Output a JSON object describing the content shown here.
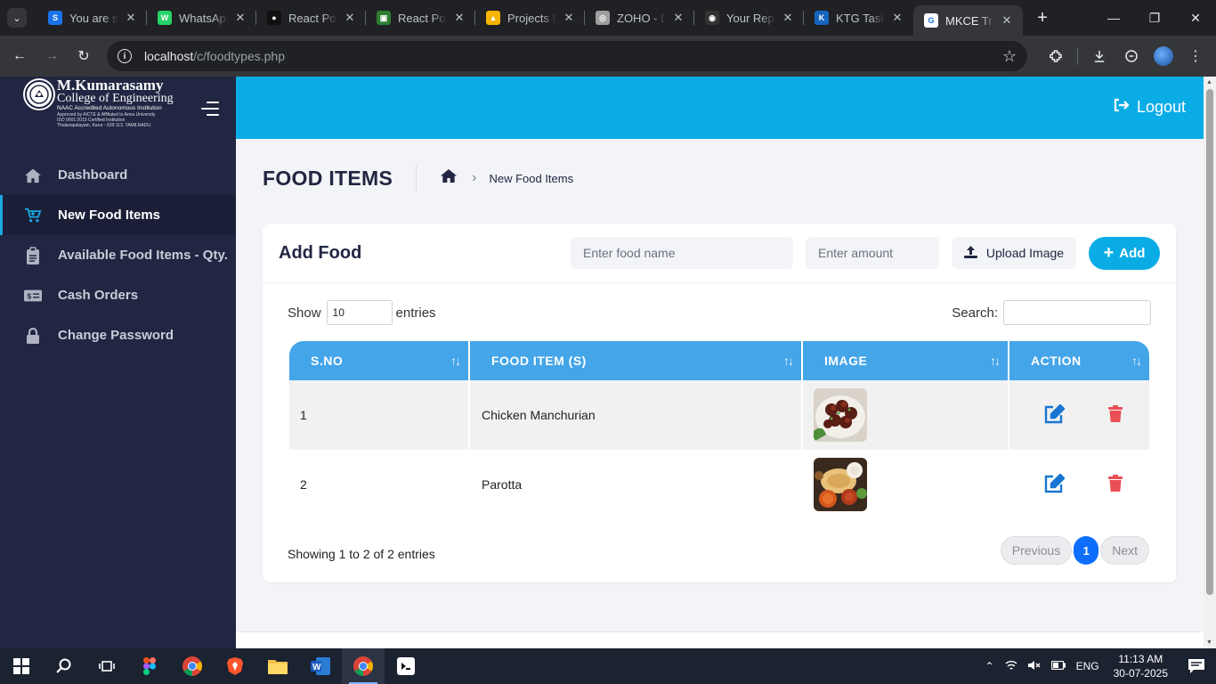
{
  "browser": {
    "tabs": [
      {
        "title": "You are signed in",
        "icon_color": "#1a73e8",
        "icon": "S"
      },
      {
        "title": "WhatsApp",
        "icon_color": "#25d366",
        "icon": "W"
      },
      {
        "title": "React Portfolio",
        "icon_color": "#111111",
        "icon": "●"
      },
      {
        "title": "React Portfolio",
        "icon_color": "#2e7d32",
        "icon": "▣"
      },
      {
        "title": "Projects Drive",
        "icon_color": "#f4b400",
        "icon": "▲"
      },
      {
        "title": "ZOHO - Dashboard",
        "icon_color": "#9e9e9e",
        "icon": "◎"
      },
      {
        "title": "Your Repositories",
        "icon_color": "#333333",
        "icon": "◉"
      },
      {
        "title": "KTG TaskFlow",
        "icon_color": "#1565c0",
        "icon": "K"
      },
      {
        "title": "MKCE Tray",
        "icon_color": "#ffffff",
        "icon": "G",
        "active": true
      }
    ],
    "url_host": "localhost",
    "url_path": "/c/foodtypes.php"
  },
  "sidebar": {
    "logo": {
      "line1": "M.Kumarasamy",
      "line2": "College of Engineering",
      "line3": "NAAC Accredited Autonomous Institution",
      "line4": "Approved by AICTE & Affiliated to Anna University",
      "line5": "ISO 9001:2015 Certified Institution",
      "line6": "Thalavapalayam, Karur - 639 113, TAMILNADU."
    },
    "items": [
      {
        "label": "Dashboard",
        "icon": "home-icon"
      },
      {
        "label": "New Food Items",
        "icon": "cart-icon",
        "active": true
      },
      {
        "label": "Available Food Items - Qty.",
        "icon": "clipboard-icon"
      },
      {
        "label": "Cash Orders",
        "icon": "money-icon"
      },
      {
        "label": "Change Password",
        "icon": "lock-icon"
      }
    ]
  },
  "topbar": {
    "logout_label": "Logout"
  },
  "page": {
    "title": "FOOD ITEMS",
    "breadcrumb_current": "New Food Items"
  },
  "add_food": {
    "title": "Add Food",
    "name_placeholder": "Enter food name",
    "amount_placeholder": "Enter amount",
    "upload_label": "Upload Image",
    "add_label": "Add"
  },
  "datatable": {
    "show_label": "Show",
    "entries_label": "entries",
    "length_value": "10",
    "search_label": "Search:",
    "columns": [
      "S.NO",
      "FOOD ITEM (S)",
      "IMAGE",
      "ACTION"
    ],
    "rows": [
      {
        "sno": "1",
        "name": "Chicken Manchurian"
      },
      {
        "sno": "2",
        "name": "Parotta"
      }
    ],
    "info": "Showing 1 to 2 of 2 entries",
    "prev_label": "Previous",
    "page": "1",
    "next_label": "Next"
  },
  "taskbar": {
    "time": "11:13 AM",
    "date": "30-07-2025",
    "lang": "ENG"
  },
  "colors": {
    "accent": "#0aace6",
    "sidebar_bg": "#212642",
    "table_header": "#44a5e8",
    "delete": "#ea4f56",
    "edit": "#1976d2"
  }
}
